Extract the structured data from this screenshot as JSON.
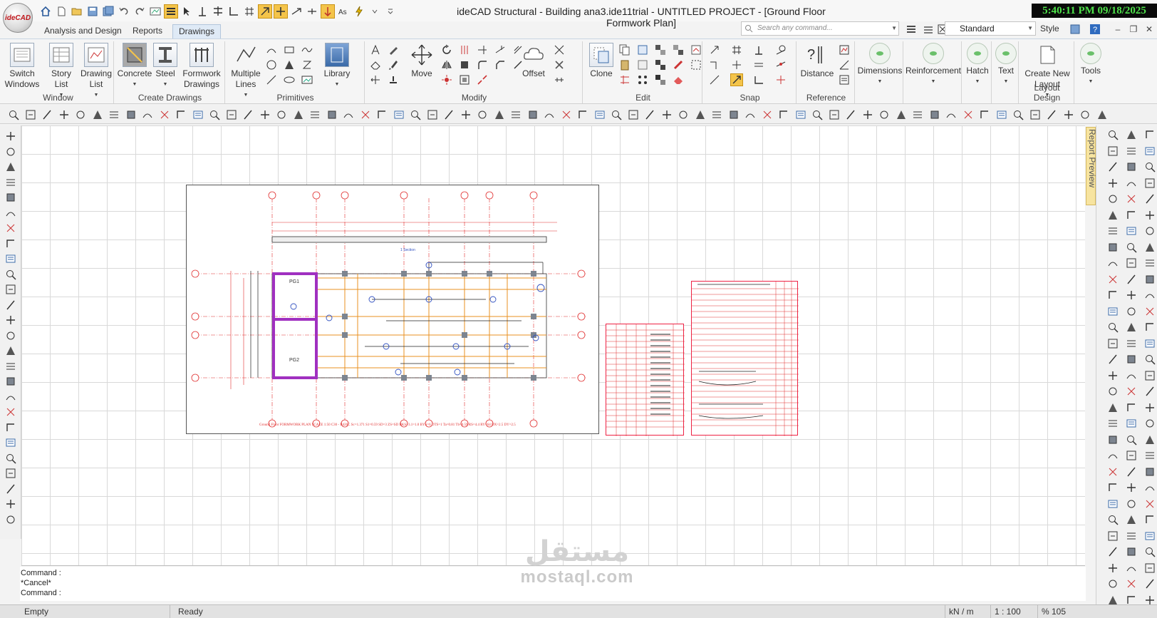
{
  "app": {
    "logo_text": "ideCAD",
    "window_title": "ideCAD Structural - Building ana3.ide11trial - UNTITLED PROJECT - [Ground Floor Formwork Plan]",
    "clock": "5:40:11 PM 09/18/2025"
  },
  "ribbon_tabs": [
    {
      "label": "Analysis and Design"
    },
    {
      "label": "Reports"
    },
    {
      "label": "Drawings"
    }
  ],
  "search": {
    "placeholder": "Search any command..."
  },
  "layer_select": {
    "value": "Standard"
  },
  "style_label": "Style",
  "ribbon_groups": {
    "window": {
      "label": "Window",
      "buttons": [
        {
          "label": "Switch Windows"
        },
        {
          "label": "Story List"
        },
        {
          "label": "Drawing List"
        }
      ]
    },
    "create_drawings": {
      "label": "Create Drawings",
      "buttons": [
        {
          "label": "Concrete"
        },
        {
          "label": "Steel"
        },
        {
          "label": "Formwork Drawings"
        }
      ]
    },
    "primitives": {
      "label": "Primitives",
      "buttons": [
        {
          "label": "Multiple Lines"
        },
        {
          "label": "Library"
        }
      ]
    },
    "modify": {
      "label": "Modify",
      "buttons": [
        {
          "label": "Move"
        },
        {
          "label": "Offset"
        }
      ]
    },
    "edit": {
      "label": "Edit",
      "buttons": [
        {
          "label": "Clone"
        }
      ]
    },
    "snap": {
      "label": "Snap"
    },
    "reference": {
      "label": "Reference",
      "buttons": [
        {
          "label": "Distance"
        }
      ]
    },
    "dimensions": {
      "label": "Dimensions"
    },
    "reinforcement": {
      "label": "Reinforcement"
    },
    "hatch": {
      "label": "Hatch"
    },
    "text": {
      "label": "Text"
    },
    "layout_design": {
      "label": "Layout Design",
      "buttons": [
        {
          "label": "Create New Layout"
        }
      ]
    },
    "tools": {
      "label": "Tools"
    }
  },
  "side_tab": {
    "label": "Report Preview"
  },
  "drawing": {
    "panels": [
      "PG1",
      "PG2"
    ],
    "section_label": "1 Section",
    "caption": "Ground Floor FORMWORK PLAN SCALE 1:50 C30 - B420C   Sc=1.371 S1=0.59  SD=3 ZS=SD  BKS=3.1=1.0  BYS=6  DTS=1  Ta=0.81 Tb=0.59  RS=4.4 RY=64  DX=2.5  DY=2.5"
  },
  "command_lines": [
    "Command :",
    "*Cancel*",
    "Command :"
  ],
  "status": {
    "left": "Empty",
    "state": "Ready",
    "units": "kN / m",
    "scale": "1 : 100",
    "zoom": "% 105"
  },
  "watermark": {
    "arabic": "مستقل",
    "latin": "mostaql.com"
  },
  "colors": {
    "clock_bg": "#0a0a0a",
    "clock_fg": "#4ee24a",
    "drawing_red": "#e03030",
    "active_tab": "#dfeaf6",
    "highlight": "#f4c44a"
  }
}
